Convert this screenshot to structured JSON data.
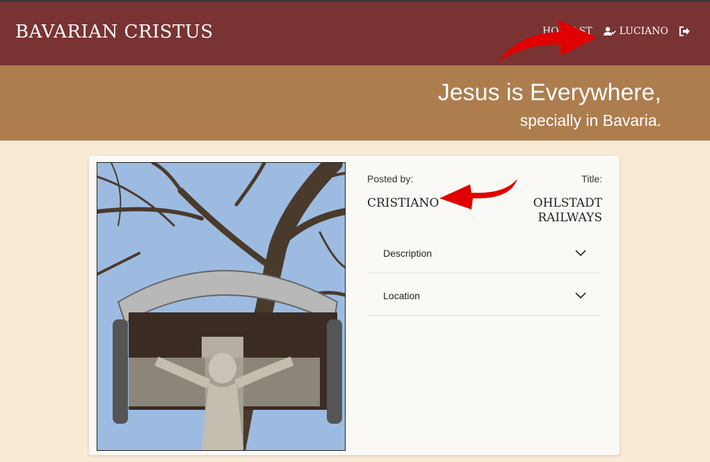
{
  "navbar": {
    "brand": "BAVARIAN CRISTUS",
    "partial_link": "HOME   ST",
    "user_label": "LUCIANO",
    "icons": [
      "user-check-icon",
      "sign-out-icon"
    ]
  },
  "hero": {
    "title": "Jesus is Everywhere,",
    "subtitle": "specially in Bavaria."
  },
  "post": {
    "posted_by_label": "Posted by:",
    "poster": "CRISTIANO",
    "title_label": "Title:",
    "title": "OHLSTADT RAILWAYS",
    "accordions": [
      {
        "label": "Description"
      },
      {
        "label": "Location"
      }
    ]
  },
  "colors": {
    "navbar": "#7a3333",
    "hero": "#ad7d4e",
    "page": "#f9ead6",
    "arrow": "#e00000"
  }
}
